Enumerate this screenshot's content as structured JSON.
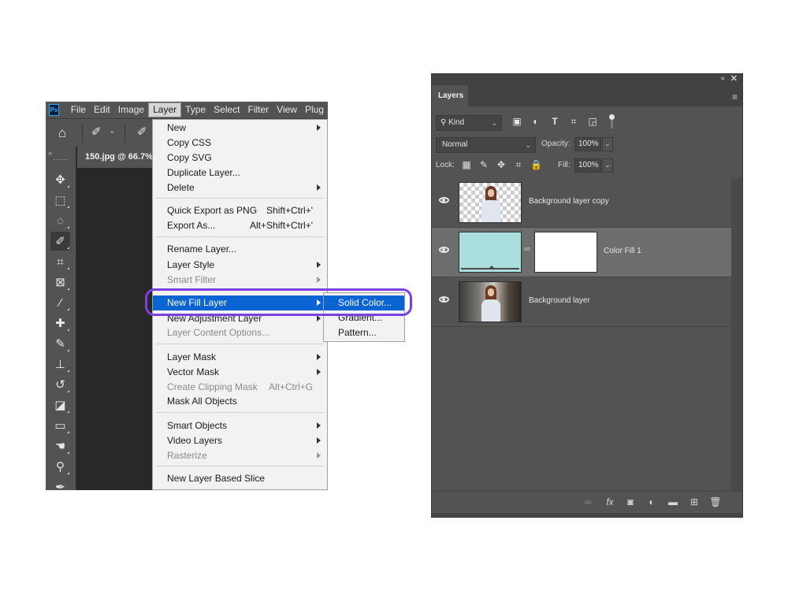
{
  "menubar": {
    "logo": "Ps",
    "items": [
      "File",
      "Edit",
      "Image",
      "Layer",
      "Type",
      "Select",
      "Filter",
      "View",
      "Plug"
    ]
  },
  "document_tab": "150.jpg @ 66.7%",
  "tools": [
    "move-icon",
    "marquee-icon",
    "lasso-icon",
    "quick-select-icon",
    "crop-icon",
    "frame-icon",
    "eyedropper-icon",
    "healing-icon",
    "brush-icon",
    "stamp-icon",
    "history-brush-icon",
    "eraser-icon",
    "gradient-icon",
    "smudge-icon",
    "dodge-icon",
    "pen-icon"
  ],
  "layer_menu": {
    "items": [
      {
        "label": "New",
        "submenu": true
      },
      {
        "label": "Copy CSS"
      },
      {
        "label": "Copy SVG"
      },
      {
        "label": "Duplicate Layer..."
      },
      {
        "label": "Delete",
        "submenu": true
      },
      {
        "label": "Quick Export as PNG",
        "shortcut": "Shift+Ctrl+'"
      },
      {
        "label": "Export As...",
        "shortcut": "Alt+Shift+Ctrl+'"
      },
      {
        "label": "Rename Layer..."
      },
      {
        "label": "Layer Style",
        "submenu": true
      },
      {
        "label": "Smart Filter",
        "submenu": true,
        "disabled": true
      },
      {
        "label": "New Fill Layer",
        "submenu": true,
        "highlighted": true
      },
      {
        "label": "New Adjustment Layer",
        "submenu": true
      },
      {
        "label": "Layer Content Options...",
        "disabled": true
      },
      {
        "label": "Layer Mask",
        "submenu": true
      },
      {
        "label": "Vector Mask",
        "submenu": true
      },
      {
        "label": "Create Clipping Mask",
        "shortcut": "Alt+Ctrl+G",
        "disabled": true
      },
      {
        "label": "Mask All Objects"
      },
      {
        "label": "Smart Objects",
        "submenu": true
      },
      {
        "label": "Video Layers",
        "submenu": true
      },
      {
        "label": "Rasterize",
        "submenu": true,
        "disabled": true
      },
      {
        "label": "New Layer Based Slice"
      }
    ]
  },
  "fill_submenu": {
    "items": [
      "Solid Color...",
      "Gradient...",
      "Pattern..."
    ],
    "highlighted_index": 0
  },
  "layers_panel": {
    "tab": "Layers",
    "kind_filter": "Kind",
    "blend_mode": "Normal",
    "opacity_label": "Opacity:",
    "opacity": "100%",
    "lock_label": "Lock:",
    "fill_label": "Fill:",
    "fill": "100%",
    "layers": [
      {
        "name": "Background layer copy",
        "visible": true,
        "selected": false
      },
      {
        "name": "Color Fill 1",
        "visible": true,
        "selected": true,
        "fill_color": "#abdedf"
      },
      {
        "name": "Background layer",
        "visible": true,
        "selected": false
      }
    ]
  },
  "colors": {
    "highlight_ring": "#7b3fe4",
    "menu_highlight": "#0a64d2"
  }
}
